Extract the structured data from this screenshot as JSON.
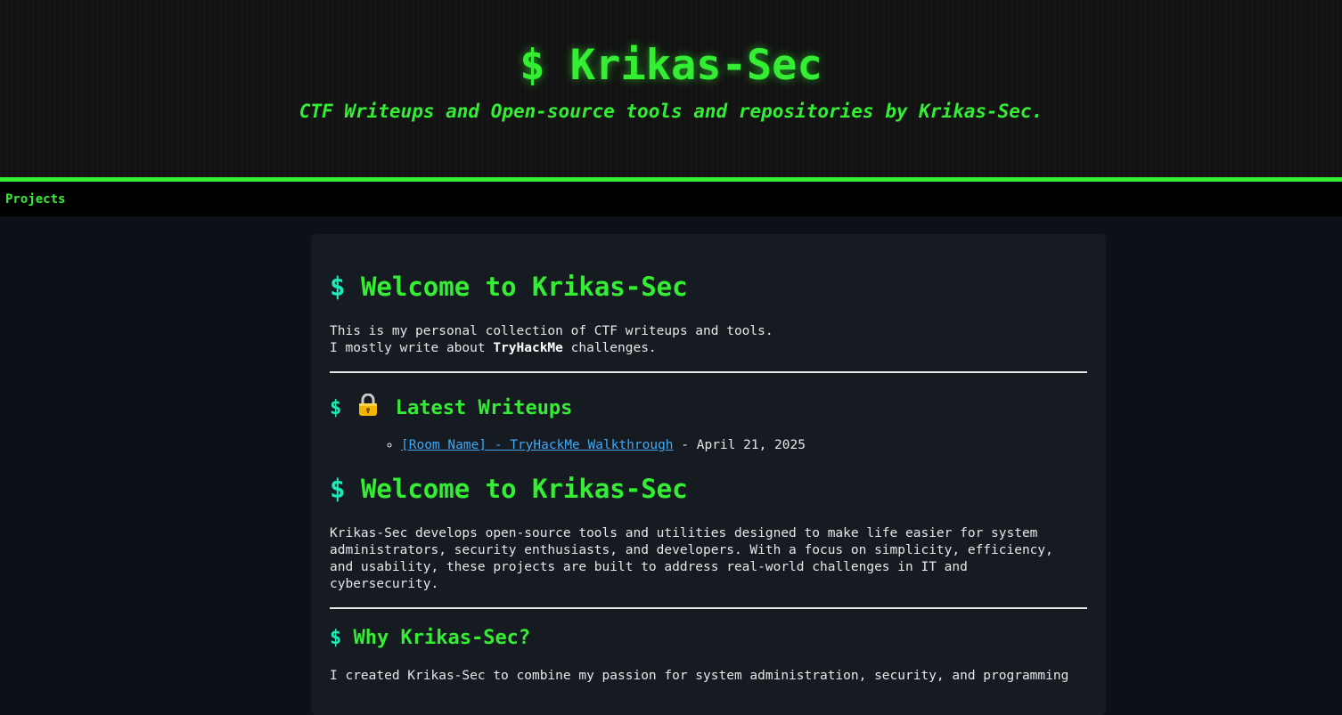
{
  "header": {
    "title": "$ Krikas-Sec",
    "subtitle": "CTF Writeups and Open-source tools and repositories by Krikas-Sec."
  },
  "nav": {
    "items": [
      {
        "label": "Projects"
      }
    ]
  },
  "main": {
    "welcome1": {
      "prompt": "$",
      "heading": "Welcome to Krikas-Sec",
      "line1": "This is my personal collection of CTF writeups and tools.",
      "line2_prefix": "I mostly write about ",
      "line2_bold": "TryHackMe",
      "line2_suffix": " challenges."
    },
    "latest": {
      "prompt": "$",
      "icon": "lock-emoji-icon",
      "heading": "Latest Writeups",
      "items": [
        {
          "link_text": "[Room Name] - TryHackMe Walkthrough",
          "date_text": " - April 21, 2025"
        }
      ]
    },
    "welcome2": {
      "prompt": "$",
      "heading": "Welcome to Krikas-Sec",
      "paragraph_lines": [
        "Krikas-Sec develops open-source tools and utilities designed to make life easier for system",
        "administrators, security enthusiasts, and developers. With a focus on simplicity, efficiency,",
        "and usability, these projects are built to address real-world challenges in IT and",
        "cybersecurity."
      ]
    },
    "why": {
      "prompt": "$",
      "heading": "Why Krikas-Sec?",
      "paragraph_partial": "I created Krikas-Sec to combine my passion for system administration, security, and programming"
    }
  },
  "colors": {
    "accent_green": "#33ee33",
    "prompt_teal": "#1de9b6",
    "link_blue": "#3fa9f5",
    "page_bg": "#0d1117",
    "card_bg": "#161b22"
  }
}
